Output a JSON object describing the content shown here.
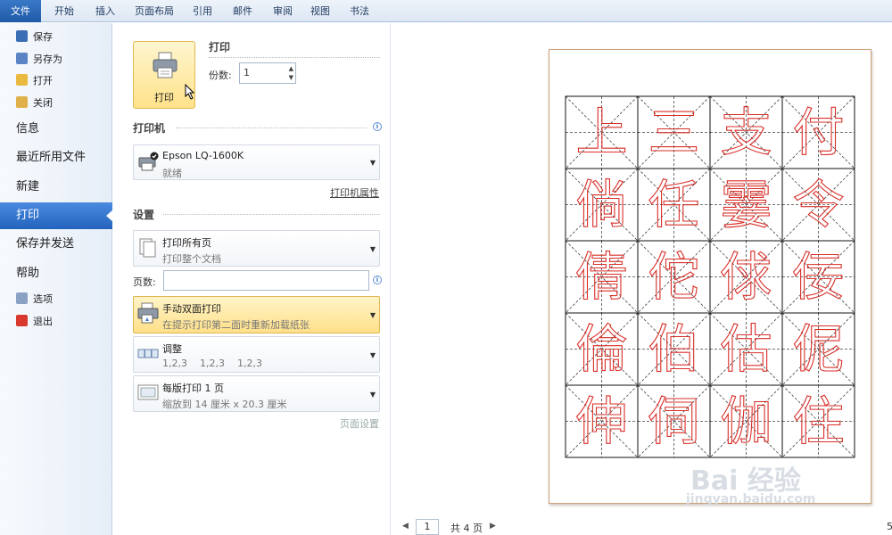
{
  "ribbon": {
    "tabs": [
      "文件",
      "开始",
      "插入",
      "页面布局",
      "引用",
      "邮件",
      "审阅",
      "视图",
      "书法"
    ]
  },
  "backstage_nav": {
    "quick": [
      {
        "label": "保存",
        "icon": "save-icon"
      },
      {
        "label": "另存为",
        "icon": "save-as-icon"
      },
      {
        "label": "打开",
        "icon": "open-folder-icon"
      },
      {
        "label": "关闭",
        "icon": "close-folder-icon"
      }
    ],
    "sections": [
      "信息",
      "最近所用文件",
      "新建",
      "打印",
      "保存并发送",
      "帮助"
    ],
    "active": "打印",
    "bottom": [
      {
        "label": "选项",
        "icon": "options-icon"
      },
      {
        "label": "退出",
        "icon": "exit-icon"
      }
    ]
  },
  "print": {
    "button_label": "打印",
    "header": "打印",
    "copies_label": "份数:",
    "copies_value": "1"
  },
  "printer": {
    "header": "打印机",
    "name": "Epson LQ-1600K",
    "status": "就绪",
    "properties_link": "打印机属性"
  },
  "settings": {
    "header": "设置",
    "pages_label": "页数:",
    "pages_value": "",
    "items": [
      {
        "title": "打印所有页",
        "sub": "打印整个文档",
        "icon": "pages-icon"
      },
      {
        "title": "手动双面打印",
        "sub": "在提示打印第二面时重新加载纸张",
        "icon": "duplex-printer-icon"
      },
      {
        "title": "调整",
        "sub": "1,2,3    1,2,3    1,2,3",
        "icon": "collate-icon"
      },
      {
        "title": "每版打印 1 页",
        "sub": "缩放到 14 厘米 x 20.3 厘米",
        "icon": "page-per-sheet-icon"
      }
    ],
    "page_setup_link": "页面设置"
  },
  "preview": {
    "characters": [
      "上",
      "三",
      "支",
      "付",
      "倘",
      "任",
      "霎",
      "令",
      "倩",
      "佗",
      "俅",
      "佞",
      "倫",
      "伯",
      "估",
      "伲",
      "伸",
      "伺",
      "伽",
      "住"
    ],
    "grid_cols": 4,
    "grid_rows": 5,
    "char_color": "#d9302a",
    "current_page": "1",
    "total_pages": "共 4 页",
    "zoom": "5"
  },
  "watermark": {
    "logo": "Bai 经验",
    "url": "jingyan.baidu.com"
  },
  "colors": {
    "accent": "#2463bd",
    "highlight": "#ffe08a"
  }
}
